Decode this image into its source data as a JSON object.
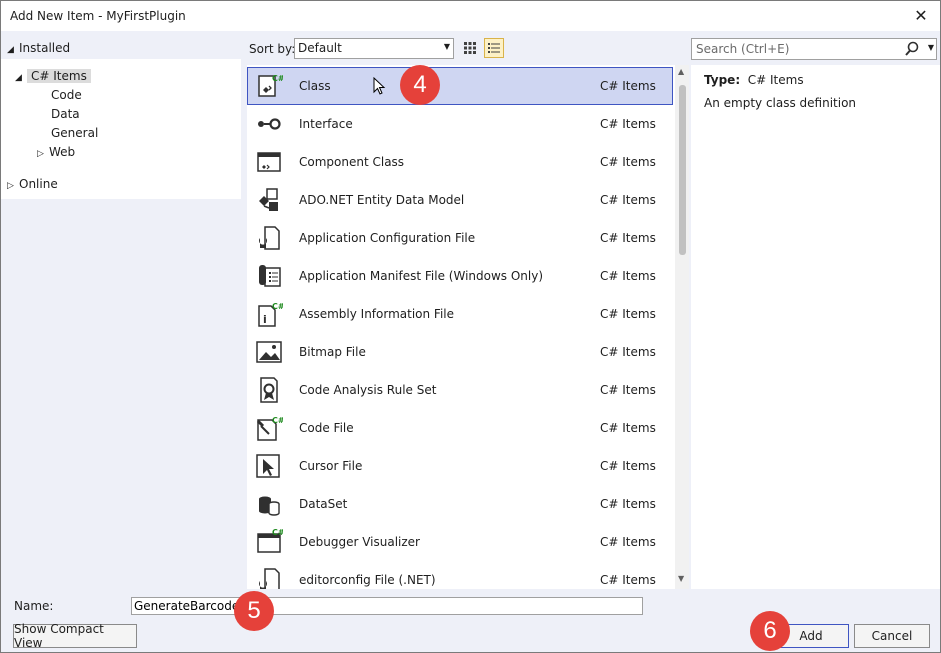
{
  "window": {
    "title": "Add New Item - MyFirstPlugin",
    "close_glyph": "✕"
  },
  "tree": {
    "installed": "Installed",
    "csharp_items": "C# Items",
    "children": [
      "Code",
      "Data",
      "General",
      "Web"
    ],
    "online": "Online"
  },
  "toolbar": {
    "sort_label": "Sort by:",
    "sort_value": "Default"
  },
  "search": {
    "placeholder": "Search (Ctrl+E)"
  },
  "items": [
    {
      "name": "Class",
      "category": "C# Items",
      "icon": "class-icon"
    },
    {
      "name": "Interface",
      "category": "C# Items",
      "icon": "interface-icon"
    },
    {
      "name": "Component Class",
      "category": "C# Items",
      "icon": "component-class-icon"
    },
    {
      "name": "ADO.NET Entity Data Model",
      "category": "C# Items",
      "icon": "entity-model-icon"
    },
    {
      "name": "Application Configuration File",
      "category": "C# Items",
      "icon": "config-file-icon"
    },
    {
      "name": "Application Manifest File (Windows Only)",
      "category": "C# Items",
      "icon": "manifest-icon"
    },
    {
      "name": "Assembly Information File",
      "category": "C# Items",
      "icon": "assembly-info-icon"
    },
    {
      "name": "Bitmap File",
      "category": "C# Items",
      "icon": "bitmap-icon"
    },
    {
      "name": "Code Analysis Rule Set",
      "category": "C# Items",
      "icon": "rule-set-icon"
    },
    {
      "name": "Code File",
      "category": "C# Items",
      "icon": "code-file-icon"
    },
    {
      "name": "Cursor File",
      "category": "C# Items",
      "icon": "cursor-file-icon"
    },
    {
      "name": "DataSet",
      "category": "C# Items",
      "icon": "dataset-icon"
    },
    {
      "name": "Debugger Visualizer",
      "category": "C# Items",
      "icon": "debugger-visualizer-icon"
    },
    {
      "name": "editorconfig File (.NET)",
      "category": "C# Items",
      "icon": "editorconfig-icon"
    }
  ],
  "details": {
    "type_label": "Type:",
    "type_value": "C# Items",
    "description": "An empty class definition"
  },
  "name_field": {
    "label": "Name:",
    "value": "GenerateBarcode"
  },
  "buttons": {
    "compact": "Show Compact View",
    "add": "Add",
    "cancel": "Cancel"
  },
  "badges": [
    "4",
    "5",
    "6"
  ],
  "colors": {
    "selection": "#cfd6f2",
    "selection_border": "#3f55c2",
    "badge": "#e5413a",
    "csharp_green": "#1e8a1e"
  }
}
